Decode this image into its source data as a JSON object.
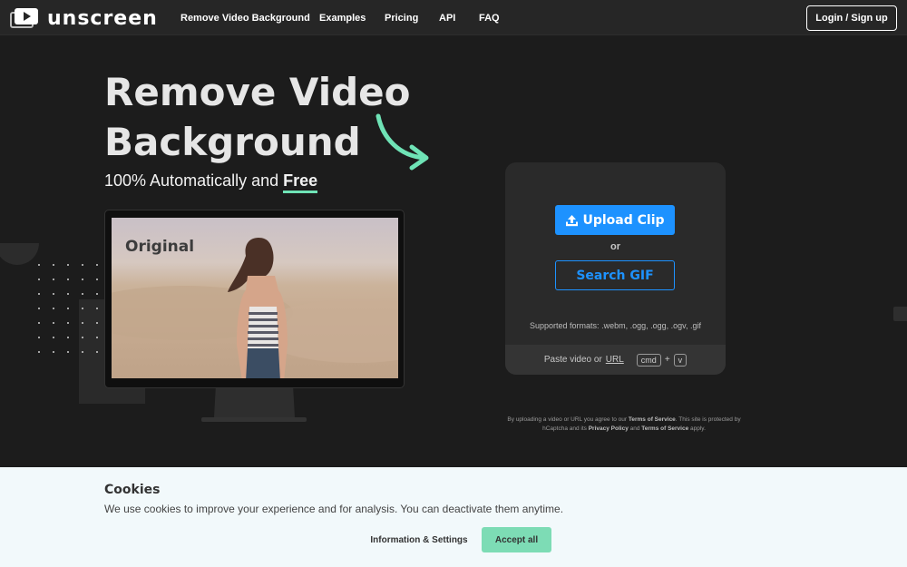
{
  "brand": {
    "logo_text": "unscreen",
    "accent_color": "#1d92ff",
    "highlight_color": "#6fe3b6"
  },
  "nav": {
    "items": [
      {
        "label": "Remove Video Background"
      },
      {
        "label": "Examples"
      },
      {
        "label": "Pricing"
      },
      {
        "label": "API"
      },
      {
        "label": "FAQ"
      }
    ],
    "login_label": "Login / Sign up"
  },
  "hero": {
    "title_line1": "Remove Video",
    "title_line2": "Background",
    "subtitle_prefix": "100% Automatically and ",
    "subtitle_highlight": "Free",
    "preview_label": "Original"
  },
  "upload": {
    "upload_label": "Upload Clip",
    "upload_icon": "upload-icon",
    "or_label": "or",
    "gif_label": "Search GIF",
    "formats_label": "Supported formats:",
    "formats_list": ".webm, .ogg, .ogg, .ogv, .gif",
    "paste_prefix": "Paste video or",
    "paste_url": "URL",
    "key_cmd": "cmd",
    "key_plus": "+",
    "key_v": "v"
  },
  "terms": {
    "part1": "By uploading a video or URL you agree to our",
    "tos1": "Terms of Service",
    "part2": ". This site is protected by hCaptcha and its",
    "privacy": "Privacy Policy",
    "part3": "and",
    "tos2": "Terms of Service",
    "part4": "apply."
  },
  "cookie": {
    "title": "Cookies",
    "text": "We use cookies to improve your experience and for analysis. You can deactivate them anytime.",
    "info_label": "Information & Settings",
    "accept_label": "Accept all",
    "accept_color": "#7ddcb5"
  }
}
